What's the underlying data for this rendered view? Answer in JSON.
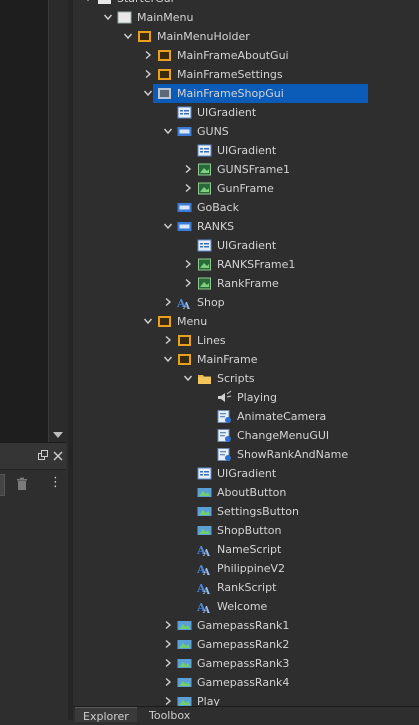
{
  "explorer": {
    "rows": [
      {
        "label": "StarterGui",
        "depth": 0,
        "chev": "down",
        "icon": "startergui",
        "clip_top": true
      },
      {
        "label": "MainMenu",
        "depth": 1,
        "chev": "down",
        "icon": "screengui"
      },
      {
        "label": "MainMenuHolder",
        "depth": 2,
        "chev": "down",
        "icon": "frame"
      },
      {
        "label": "MainFrameAboutGui",
        "depth": 3,
        "chev": "right",
        "icon": "frame"
      },
      {
        "label": "MainFrameSettings",
        "depth": 3,
        "chev": "right",
        "icon": "frame"
      },
      {
        "label": "MainFrameShopGui",
        "depth": 3,
        "chev": "down",
        "icon": "frame-grey",
        "selected": true
      },
      {
        "label": "UIGradient",
        "depth": 4,
        "chev": "",
        "icon": "uigradient"
      },
      {
        "label": "GUNS",
        "depth": 4,
        "chev": "down",
        "icon": "textlabel"
      },
      {
        "label": "UIGradient",
        "depth": 5,
        "chev": "",
        "icon": "uigradient"
      },
      {
        "label": "GUNSFrame1",
        "depth": 5,
        "chev": "right",
        "icon": "imagelabel"
      },
      {
        "label": "GunFrame",
        "depth": 5,
        "chev": "right",
        "icon": "imagelabel"
      },
      {
        "label": "GoBack",
        "depth": 4,
        "chev": "",
        "icon": "textbutton"
      },
      {
        "label": "RANKS",
        "depth": 4,
        "chev": "down",
        "icon": "textlabel"
      },
      {
        "label": "UIGradient",
        "depth": 5,
        "chev": "",
        "icon": "uigradient"
      },
      {
        "label": "RANKSFrame1",
        "depth": 5,
        "chev": "right",
        "icon": "imagelabel"
      },
      {
        "label": "RankFrame",
        "depth": 5,
        "chev": "right",
        "icon": "imagelabel"
      },
      {
        "label": "Shop",
        "depth": 4,
        "chev": "right",
        "icon": "textlabel-a"
      },
      {
        "label": "Menu",
        "depth": 3,
        "chev": "down",
        "icon": "frame"
      },
      {
        "label": "Lines",
        "depth": 4,
        "chev": "right",
        "icon": "frame"
      },
      {
        "label": "MainFrame",
        "depth": 4,
        "chev": "down",
        "icon": "frame"
      },
      {
        "label": "Scripts",
        "depth": 5,
        "chev": "down",
        "icon": "folder"
      },
      {
        "label": "Playing",
        "depth": 6,
        "chev": "",
        "icon": "sound"
      },
      {
        "label": "AnimateCamera",
        "depth": 6,
        "chev": "",
        "icon": "localscript"
      },
      {
        "label": "ChangeMenuGUI",
        "depth": 6,
        "chev": "",
        "icon": "localscript"
      },
      {
        "label": "ShowRankAndName",
        "depth": 6,
        "chev": "",
        "icon": "localscript"
      },
      {
        "label": "UIGradient",
        "depth": 5,
        "chev": "",
        "icon": "uigradient"
      },
      {
        "label": "AboutButton",
        "depth": 5,
        "chev": "",
        "icon": "imagebutton"
      },
      {
        "label": "SettingsButton",
        "depth": 5,
        "chev": "",
        "icon": "imagebutton"
      },
      {
        "label": "ShopButton",
        "depth": 5,
        "chev": "",
        "icon": "imagebutton"
      },
      {
        "label": "NameScript",
        "depth": 5,
        "chev": "",
        "icon": "textlabel-a"
      },
      {
        "label": "PhilippineV2",
        "depth": 5,
        "chev": "",
        "icon": "textlabel-a"
      },
      {
        "label": "RankScript",
        "depth": 5,
        "chev": "",
        "icon": "textlabel-a"
      },
      {
        "label": "Welcome",
        "depth": 5,
        "chev": "",
        "icon": "textlabel-a"
      },
      {
        "label": "GamepassRank1",
        "depth": 4,
        "chev": "right",
        "icon": "imagebutton"
      },
      {
        "label": "GamepassRank2",
        "depth": 4,
        "chev": "right",
        "icon": "imagebutton"
      },
      {
        "label": "GamepassRank3",
        "depth": 4,
        "chev": "right",
        "icon": "imagebutton"
      },
      {
        "label": "GamepassRank4",
        "depth": 4,
        "chev": "right",
        "icon": "imagebutton"
      },
      {
        "label": "Play",
        "depth": 4,
        "chev": "right",
        "icon": "imagebutton"
      }
    ]
  },
  "tabs": [
    {
      "label": "Explorer",
      "active": true
    },
    {
      "label": "Toolbox",
      "active": false
    }
  ]
}
